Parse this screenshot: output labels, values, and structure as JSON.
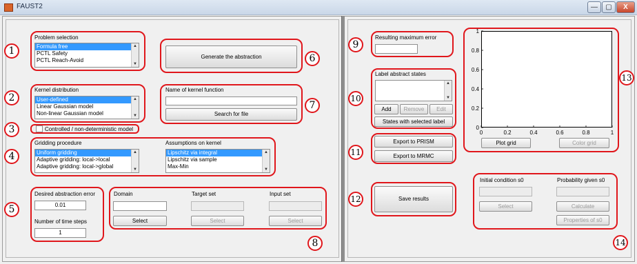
{
  "window": {
    "title": "FAUST2",
    "minimize": "—",
    "maximize": "▢",
    "close": "X"
  },
  "problem_selection": {
    "title": "Problem selection",
    "items": [
      "Formula free",
      "PCTL Safety",
      "PCTL Reach-Avoid"
    ],
    "selected": "Formula free"
  },
  "generate_button": "Generate the abstraction",
  "kernel_distribution": {
    "title": "Kernel distribution",
    "items": [
      "User-defined",
      "Linear Gaussian model",
      "Non-linear Gaussian model"
    ],
    "selected": "User-defined"
  },
  "kernel_function": {
    "title": "Name of kernel function",
    "value": "",
    "search_button": "Search for file"
  },
  "controlled_checkbox": {
    "label": "Controlled / non-deterministic model",
    "checked": false
  },
  "gridding": {
    "title": "Gridding procedure",
    "items": [
      "Uniform gridding",
      "Adaptive gridding: local->local",
      "Adaptive gridding: local->global"
    ],
    "selected": "Uniform gridding"
  },
  "assumptions": {
    "title": "Assumptions on kernel",
    "items": [
      "Lipschitz via integral",
      "Lipschitz via sample",
      "Max-Min"
    ],
    "selected": "Lipschitz via integral"
  },
  "desired_error": {
    "label": "Desired abstraction error",
    "value": "0.01"
  },
  "time_steps": {
    "label": "Number of time steps",
    "value": "1"
  },
  "sets": {
    "domain": {
      "label": "Domain",
      "button": "Select"
    },
    "target": {
      "label": "Target set",
      "button": "Select"
    },
    "input": {
      "label": "Input set",
      "button": "Select"
    }
  },
  "max_error": {
    "label": "Resulting maximum error",
    "value": ""
  },
  "label_states": {
    "title": "Label abstract states",
    "add": "Add",
    "remove": "Remove",
    "edit": "Edit",
    "states_with_label": "States with selected label"
  },
  "export": {
    "prism": "Export to PRISM",
    "mrmc": "Export to MRMC"
  },
  "save_results": "Save results",
  "plot": {
    "plot_grid": "Plot grid",
    "color_grid": "Color grid"
  },
  "chart_data": {
    "type": "line",
    "series": [],
    "xlim": [
      0,
      1
    ],
    "ylim": [
      0,
      1
    ],
    "x_ticks": [
      "0",
      "0.2",
      "0.4",
      "0.6",
      "0.8",
      "1"
    ],
    "y_ticks": [
      "0",
      "0.2",
      "0.4",
      "0.6",
      "0.8",
      "1"
    ],
    "grid": false
  },
  "initial_condition": {
    "label": "Initial condition s0",
    "select": "Select"
  },
  "probability": {
    "label": "Probability given s0",
    "calculate": "Calculate",
    "properties": "Properties of s0"
  },
  "callouts": [
    "1",
    "2",
    "3",
    "4",
    "5",
    "6",
    "7",
    "8",
    "9",
    "10",
    "11",
    "12",
    "13",
    "14"
  ]
}
